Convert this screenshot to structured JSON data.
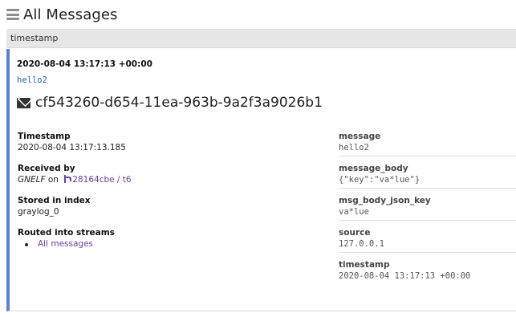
{
  "header": {
    "title": "All Messages",
    "menu_icon": "hamburger-icon"
  },
  "table": {
    "column_header": "timestamp"
  },
  "message": {
    "timestamp": "2020-08-04 13:17:13 +00:00",
    "text": "hello2",
    "id": "cf543260-d654-11ea-963b-9a2f3a9026b1",
    "id_icon": "envelope-icon",
    "meta": {
      "timestamp_label": "Timestamp",
      "timestamp_value": "2020-08-04 13:17:13.185",
      "received_by_label": "Received by",
      "received_by_input": "GNELF",
      "received_by_on": "on",
      "received_by_node": "28164cbe / t6",
      "stored_label": "Stored in index",
      "stored_value": "graylog_0",
      "routed_label": "Routed into streams",
      "streams": [
        "All messages"
      ]
    },
    "fields": [
      {
        "name": "message",
        "value": "hello2"
      },
      {
        "name": "message_body",
        "value": "{\"key\":\"va*lue\"}"
      },
      {
        "name": "msg_body_json_key",
        "value": "va*lue"
      },
      {
        "name": "source",
        "value": "127.0.0.1"
      },
      {
        "name": "timestamp",
        "value": "2020-08-04 13:17:13 +00:00"
      }
    ]
  },
  "colors": {
    "accent_bar": "#5b7fd6",
    "link": "#6c3fa0",
    "message_text": "#2a63a6",
    "header_bg": "#e6e6e6"
  }
}
